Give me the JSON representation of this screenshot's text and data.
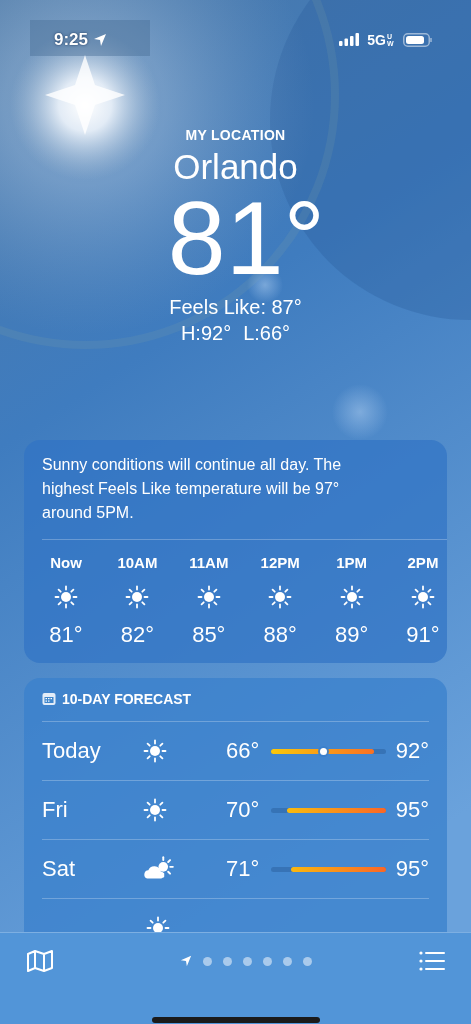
{
  "status_bar": {
    "time": "9:25",
    "network": "5G",
    "network_badge": "UW"
  },
  "header": {
    "label": "MY LOCATION",
    "city": "Orlando",
    "temperature": "81°",
    "feels_like": "Feels Like: 87°",
    "high": "H:92°",
    "low": "L:66°"
  },
  "hourly": {
    "summary": "Sunny conditions will continue all day. The highest Feels Like temperature will be 97° around 5PM.",
    "hours": [
      {
        "time": "Now",
        "kind": "sun",
        "temperature": "81°"
      },
      {
        "time": "10AM",
        "kind": "sun",
        "temperature": "82°"
      },
      {
        "time": "11AM",
        "kind": "sun",
        "temperature": "85°"
      },
      {
        "time": "12PM",
        "kind": "sun",
        "temperature": "88°"
      },
      {
        "time": "1PM",
        "kind": "sun",
        "temperature": "89°"
      },
      {
        "time": "2PM",
        "kind": "sun",
        "temperature": "91°"
      }
    ]
  },
  "forecast": {
    "title": "10-DAY FORECAST",
    "days": [
      {
        "day": "Today",
        "kind": "sun",
        "low": "66°",
        "high": "92°",
        "level": 0.46
      },
      {
        "day": "Fri",
        "kind": "sun",
        "low": "70°",
        "high": "95°"
      },
      {
        "day": "Sat",
        "kind": "partly-cloudy",
        "low": "71°",
        "high": "95°"
      },
      {
        "kind": "sun"
      }
    ]
  },
  "pages": [
    {
      "kind": "location",
      "selected": true
    },
    {
      "kind": "dot",
      "selected": false
    },
    {
      "kind": "dot",
      "selected": false
    },
    {
      "kind": "dot",
      "selected": false
    },
    {
      "kind": "dot",
      "selected": false
    },
    {
      "kind": "dot",
      "selected": false
    },
    {
      "kind": "dot",
      "selected": false
    }
  ]
}
